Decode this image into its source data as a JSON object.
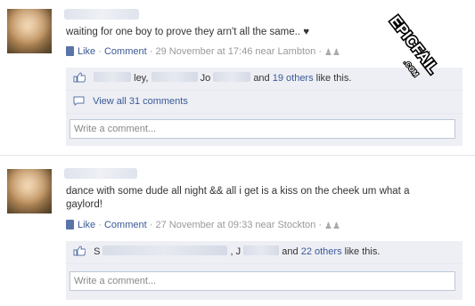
{
  "posts": [
    {
      "message": "waiting for one boy to prove they arn't all the same.. ♥",
      "like_label": "Like",
      "comment_label": "Comment",
      "timestamp": "29 November at 17:46 near Lambton",
      "likes_names_1": "ley,",
      "likes_names_2": "Jo",
      "likes_and": "and",
      "likes_count": "19 others",
      "likes_suffix": "like this.",
      "view_comments": "View all 31 comments",
      "comment_placeholder": "Write a comment..."
    },
    {
      "message": "dance with some dude all night && all i get is a kiss on the cheek um what a gaylord!",
      "like_label": "Like",
      "comment_label": "Comment",
      "timestamp": "27 November at 09:33 near Stockton",
      "likes_names_1": "S",
      "likes_names_2": ", J",
      "likes_and": "and",
      "likes_count": "22 others",
      "likes_suffix": "like this.",
      "comment_placeholder": "Write a comment..."
    }
  ],
  "watermark": {
    "text": "EPICFAIL",
    "suffix": ".COM"
  },
  "separator": "·",
  "colors": {
    "link": "#3b5998",
    "ufi_bg": "#edeff4",
    "meta": "#999999"
  }
}
